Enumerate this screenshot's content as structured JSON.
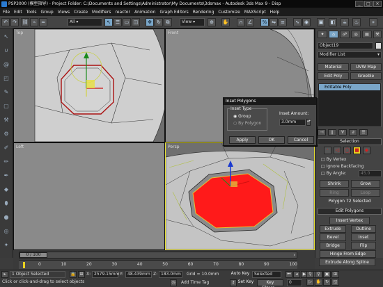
{
  "window": {
    "title": "PSP3000 (模型指导) - Project Folder: C:\\Documents and Settings\\Administrator\\My Documents\\3dsmax - Autodesk 3ds Max 9 - Disp",
    "min": "_",
    "max": "□",
    "close": "×"
  },
  "menu": [
    "File",
    "Edit",
    "Tools",
    "Group",
    "Views",
    "Create",
    "Modifiers",
    "reactor",
    "Animation",
    "Graph Editors",
    "Rendering",
    "Customize",
    "MAXScript",
    "Help"
  ],
  "toolbar": {
    "selection_filter": "All",
    "ref_coord": "View"
  },
  "viewports": {
    "top": "Top",
    "front": "Front",
    "left": "Left",
    "persp": "Persp"
  },
  "panel": {
    "object_name": "Object19",
    "modifier_list": "Modifier List",
    "btn_material": "Material",
    "btn_uvw": "UVW Map",
    "btn_edit_poly": "Edit Poly",
    "btn_greeble": "Greeble",
    "stack_item": "Editable Poly",
    "selection_rollout": "Selection",
    "by_vertex": "By Vertex",
    "ignore_backfacing": "Ignore Backfacing",
    "by_angle": "By Angle:",
    "by_angle_value": "45.0",
    "shrink": "Shrink",
    "grow": "Grow",
    "ring": "Ring",
    "loop": "Loop",
    "status": "Polygon 72 Selected",
    "edit_polygons_rollout": "Edit Polygons",
    "insert_vertex": "Insert Vertex",
    "extrude": "Extrude",
    "outline": "Outline",
    "bevel": "Bevel",
    "inset": "Inset",
    "bridge": "Bridge",
    "flip": "Flip",
    "hinge": "Hinge From Edge",
    "extrude_spline": "Extrude Along Spline"
  },
  "dialog": {
    "title": "Inset Polygons",
    "inset_type_label": "Inset Type",
    "opt_group": "Group",
    "opt_by_polygon": "By Polygon",
    "inset_amount_label": "Inset Amount:",
    "inset_amount_value": "3.0mm",
    "apply": "Apply",
    "ok": "OK",
    "cancel": "Cancel"
  },
  "timeline": {
    "frame_counter": "0 / 100",
    "ticks": [
      "0",
      "10",
      "20",
      "30",
      "40",
      "50",
      "60",
      "70",
      "80",
      "90",
      "100"
    ]
  },
  "status": {
    "selection": "1 Object Selected",
    "hint": "Click or click-and-drag to select objects",
    "x_label": "X:",
    "x_value": "2579.15mm",
    "y_label": "Y:",
    "y_value": "48.439mm",
    "z_label": "Z:",
    "z_value": "183.0mm",
    "grid": "Grid = 10.0mm",
    "add_time_tag": "Add Time Tag",
    "auto_key": "Auto Key",
    "set_key": "Set Key",
    "key_mode": "Selected",
    "key_filters": "Key Filters...",
    "frame": "0"
  },
  "colors": {
    "selected_poly": "#ff1a1a",
    "viewport_bg": "#8a8a8a",
    "mesh_face": "#c8c8c8",
    "dark_ui": "#3c3c3c"
  }
}
